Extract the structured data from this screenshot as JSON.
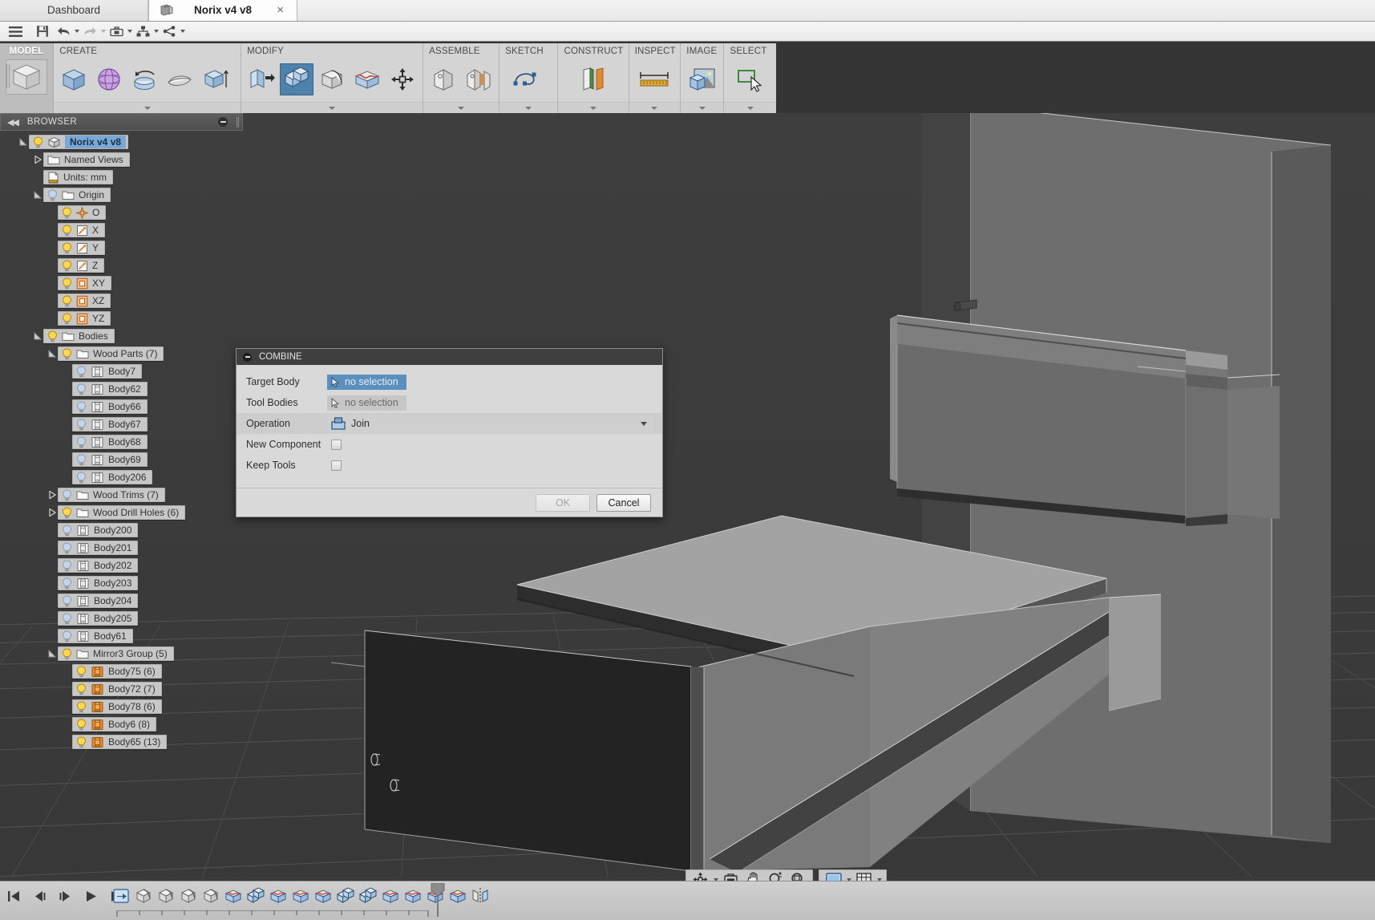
{
  "app": {
    "tabs": [
      {
        "label": "Dashboard",
        "active": false,
        "icon": "none"
      },
      {
        "label": "Norix v4 v8",
        "active": true,
        "icon": "document-icon",
        "close": "×"
      }
    ]
  },
  "quick_access": {
    "buttons": [
      {
        "name": "menu-icon",
        "label": "Menu"
      },
      {
        "name": "save-icon",
        "label": "Save"
      },
      {
        "name": "undo-icon",
        "label": "Undo"
      },
      {
        "name": "redo-icon",
        "label": "Redo"
      },
      {
        "name": "toolbox-icon",
        "label": "Tools"
      },
      {
        "name": "assembly-icon",
        "label": "Assembly Context"
      },
      {
        "name": "share-icon",
        "label": "Share"
      }
    ]
  },
  "ribbon": {
    "workspace_tab": "MODEL",
    "panels": [
      {
        "title": "CREATE",
        "icons": [
          "box-icon",
          "sphere-icon",
          "revolve-icon",
          "loft-icon",
          "extrude-icon"
        ],
        "selected_index": -1
      },
      {
        "title": "MODIFY",
        "icons": [
          "press-pull-icon",
          "combine-icon",
          "fillet-icon",
          "split-face-icon",
          "move-icon"
        ],
        "selected_index": 1
      },
      {
        "title": "ASSEMBLE",
        "icons": [
          "new-component-icon",
          "joint-icon"
        ],
        "selected_index": -1
      },
      {
        "title": "SKETCH",
        "icons": [
          "spline-icon"
        ],
        "selected_index": -1
      },
      {
        "title": "CONSTRUCT",
        "icons": [
          "offset-plane-icon"
        ],
        "selected_index": -1
      },
      {
        "title": "INSPECT",
        "icons": [
          "measure-icon"
        ],
        "selected_index": -1
      },
      {
        "title": "IMAGE",
        "icons": [
          "canvas-image-icon"
        ],
        "selected_index": -1
      },
      {
        "title": "SELECT",
        "icons": [
          "select-window-icon"
        ],
        "selected_index": -1
      }
    ]
  },
  "browser": {
    "title": "BROWSER",
    "collapse_icon": "collapse-left-icon",
    "minimize_icon": "minimize-icon",
    "tree": [
      {
        "label": "Norix v4 v8",
        "depth": 0,
        "twisty": "expanded",
        "icon": "component-icon",
        "bulb": "on",
        "root": true
      },
      {
        "label": "Named Views",
        "depth": 1,
        "twisty": "collapsed",
        "icon": "folder-icon",
        "bulb": "none",
        "root": false
      },
      {
        "label": "Units: mm",
        "depth": 1,
        "twisty": "none",
        "icon": "units-icon",
        "bulb": "none",
        "root": false
      },
      {
        "label": "Origin",
        "depth": 1,
        "twisty": "expanded",
        "icon": "folder-icon",
        "bulb": "off",
        "root": false
      },
      {
        "label": "O",
        "depth": 2,
        "twisty": "none",
        "icon": "origin-point-icon",
        "bulb": "on",
        "root": false
      },
      {
        "label": "X",
        "depth": 2,
        "twisty": "none",
        "icon": "axis-icon",
        "bulb": "on",
        "root": false
      },
      {
        "label": "Y",
        "depth": 2,
        "twisty": "none",
        "icon": "axis-icon",
        "bulb": "on",
        "root": false
      },
      {
        "label": "Z",
        "depth": 2,
        "twisty": "none",
        "icon": "axis-icon",
        "bulb": "on",
        "root": false
      },
      {
        "label": "XY",
        "depth": 2,
        "twisty": "none",
        "icon": "plane-icon",
        "bulb": "on",
        "root": false
      },
      {
        "label": "XZ",
        "depth": 2,
        "twisty": "none",
        "icon": "plane-icon",
        "bulb": "on",
        "root": false
      },
      {
        "label": "YZ",
        "depth": 2,
        "twisty": "none",
        "icon": "plane-icon",
        "bulb": "on",
        "root": false
      },
      {
        "label": "Bodies",
        "depth": 1,
        "twisty": "expanded",
        "icon": "folder-icon",
        "bulb": "on",
        "root": false
      },
      {
        "label": "Wood Parts (7)",
        "depth": 2,
        "twisty": "expanded",
        "icon": "folder-icon",
        "bulb": "on",
        "root": false
      },
      {
        "label": "Body7",
        "depth": 3,
        "twisty": "none",
        "icon": "body-icon",
        "bulb": "off",
        "root": false
      },
      {
        "label": "Body62",
        "depth": 3,
        "twisty": "none",
        "icon": "body-icon",
        "bulb": "off",
        "root": false
      },
      {
        "label": "Body66",
        "depth": 3,
        "twisty": "none",
        "icon": "body-icon",
        "bulb": "off",
        "root": false
      },
      {
        "label": "Body67",
        "depth": 3,
        "twisty": "none",
        "icon": "body-icon",
        "bulb": "off",
        "root": false
      },
      {
        "label": "Body68",
        "depth": 3,
        "twisty": "none",
        "icon": "body-icon",
        "bulb": "off",
        "root": false
      },
      {
        "label": "Body69",
        "depth": 3,
        "twisty": "none",
        "icon": "body-icon",
        "bulb": "off",
        "root": false
      },
      {
        "label": "Body206",
        "depth": 3,
        "twisty": "none",
        "icon": "body-icon",
        "bulb": "off",
        "root": false
      },
      {
        "label": "Wood Trims (7)",
        "depth": 2,
        "twisty": "collapsed",
        "icon": "folder-icon",
        "bulb": "off",
        "root": false
      },
      {
        "label": "Wood Drill Holes (6)",
        "depth": 2,
        "twisty": "collapsed",
        "icon": "folder-icon",
        "bulb": "on",
        "root": false
      },
      {
        "label": "Body200",
        "depth": 2,
        "twisty": "none",
        "icon": "body-icon",
        "bulb": "off",
        "root": false
      },
      {
        "label": "Body201",
        "depth": 2,
        "twisty": "none",
        "icon": "body-icon",
        "bulb": "off",
        "root": false
      },
      {
        "label": "Body202",
        "depth": 2,
        "twisty": "none",
        "icon": "body-icon",
        "bulb": "off",
        "root": false
      },
      {
        "label": "Body203",
        "depth": 2,
        "twisty": "none",
        "icon": "body-icon",
        "bulb": "off",
        "root": false
      },
      {
        "label": "Body204",
        "depth": 2,
        "twisty": "none",
        "icon": "body-icon",
        "bulb": "off",
        "root": false
      },
      {
        "label": "Body205",
        "depth": 2,
        "twisty": "none",
        "icon": "body-icon",
        "bulb": "off",
        "root": false
      },
      {
        "label": "Body61",
        "depth": 2,
        "twisty": "none",
        "icon": "body-icon",
        "bulb": "off",
        "root": false
      },
      {
        "label": "Mirror3 Group (5)",
        "depth": 2,
        "twisty": "expanded",
        "icon": "folder-icon",
        "bulb": "on",
        "root": false
      },
      {
        "label": "Body75 (6)",
        "depth": 3,
        "twisty": "none",
        "icon": "body-orange-icon",
        "bulb": "on",
        "root": false
      },
      {
        "label": "Body72 (7)",
        "depth": 3,
        "twisty": "none",
        "icon": "body-orange-icon",
        "bulb": "on",
        "root": false
      },
      {
        "label": "Body78 (6)",
        "depth": 3,
        "twisty": "none",
        "icon": "body-orange-icon",
        "bulb": "on",
        "root": false
      },
      {
        "label": "Body6 (8)",
        "depth": 3,
        "twisty": "none",
        "icon": "body-orange-icon",
        "bulb": "on",
        "root": false
      },
      {
        "label": "Body65 (13)",
        "depth": 3,
        "twisty": "none",
        "icon": "body-orange-icon",
        "bulb": "on",
        "root": false
      }
    ]
  },
  "dialog": {
    "title": "COMBINE",
    "rows": [
      {
        "label": "Target Body",
        "type": "selection",
        "value": "no selection",
        "active": true
      },
      {
        "label": "Tool Bodies",
        "type": "selection",
        "value": "no selection",
        "active": false
      },
      {
        "label": "Operation",
        "type": "dropdown",
        "value": "Join",
        "active": false
      },
      {
        "label": "New Component",
        "type": "checkbox",
        "value": "",
        "checked": false
      },
      {
        "label": "Keep Tools",
        "type": "checkbox",
        "value": "",
        "checked": false
      }
    ],
    "ok_label": "OK",
    "ok_enabled": false,
    "cancel_label": "Cancel"
  },
  "navbar": {
    "groups": [
      {
        "buttons": [
          {
            "name": "orbit-icon",
            "caret": true
          },
          {
            "name": "look-at-icon",
            "caret": false
          },
          {
            "name": "pan-icon",
            "caret": false
          },
          {
            "name": "zoom-icon",
            "caret": false
          },
          {
            "name": "fit-icon",
            "caret": false
          }
        ]
      },
      {
        "buttons": [
          {
            "name": "display-settings-icon",
            "caret": true
          },
          {
            "name": "grid-snap-icon",
            "caret": true
          }
        ]
      }
    ]
  },
  "timeline": {
    "playback": [
      "timeline-begin-icon",
      "timeline-step-back-icon",
      "timeline-step-forward-icon",
      "timeline-play-icon",
      "timeline-end-icon"
    ],
    "features": [
      "move-feature-icon",
      "fillet-feature-icon",
      "fillet-feature-icon",
      "fillet-feature-icon",
      "fillet-feature-icon",
      "sketch-feature-icon",
      "combine-feature-icon",
      "sketch-feature-icon",
      "sketch-feature-icon",
      "sketch-feature-icon",
      "combine-feature-icon",
      "combine-feature-icon",
      "sketch-feature-icon",
      "sketch-feature-icon",
      "sketch-feature-icon",
      "sketch-feature-icon",
      "mirror-feature-icon"
    ],
    "marker": "timeline-marker"
  },
  "viewport": {
    "cursor": "arrow-cursor",
    "colors": {
      "background": "#3b3b3b",
      "grid_line": "#555555",
      "face_light": "#a8a8a8",
      "face_mid": "#6a6a6a",
      "face_dark": "#2b2b2b",
      "edge": "#cfcfcf"
    }
  }
}
